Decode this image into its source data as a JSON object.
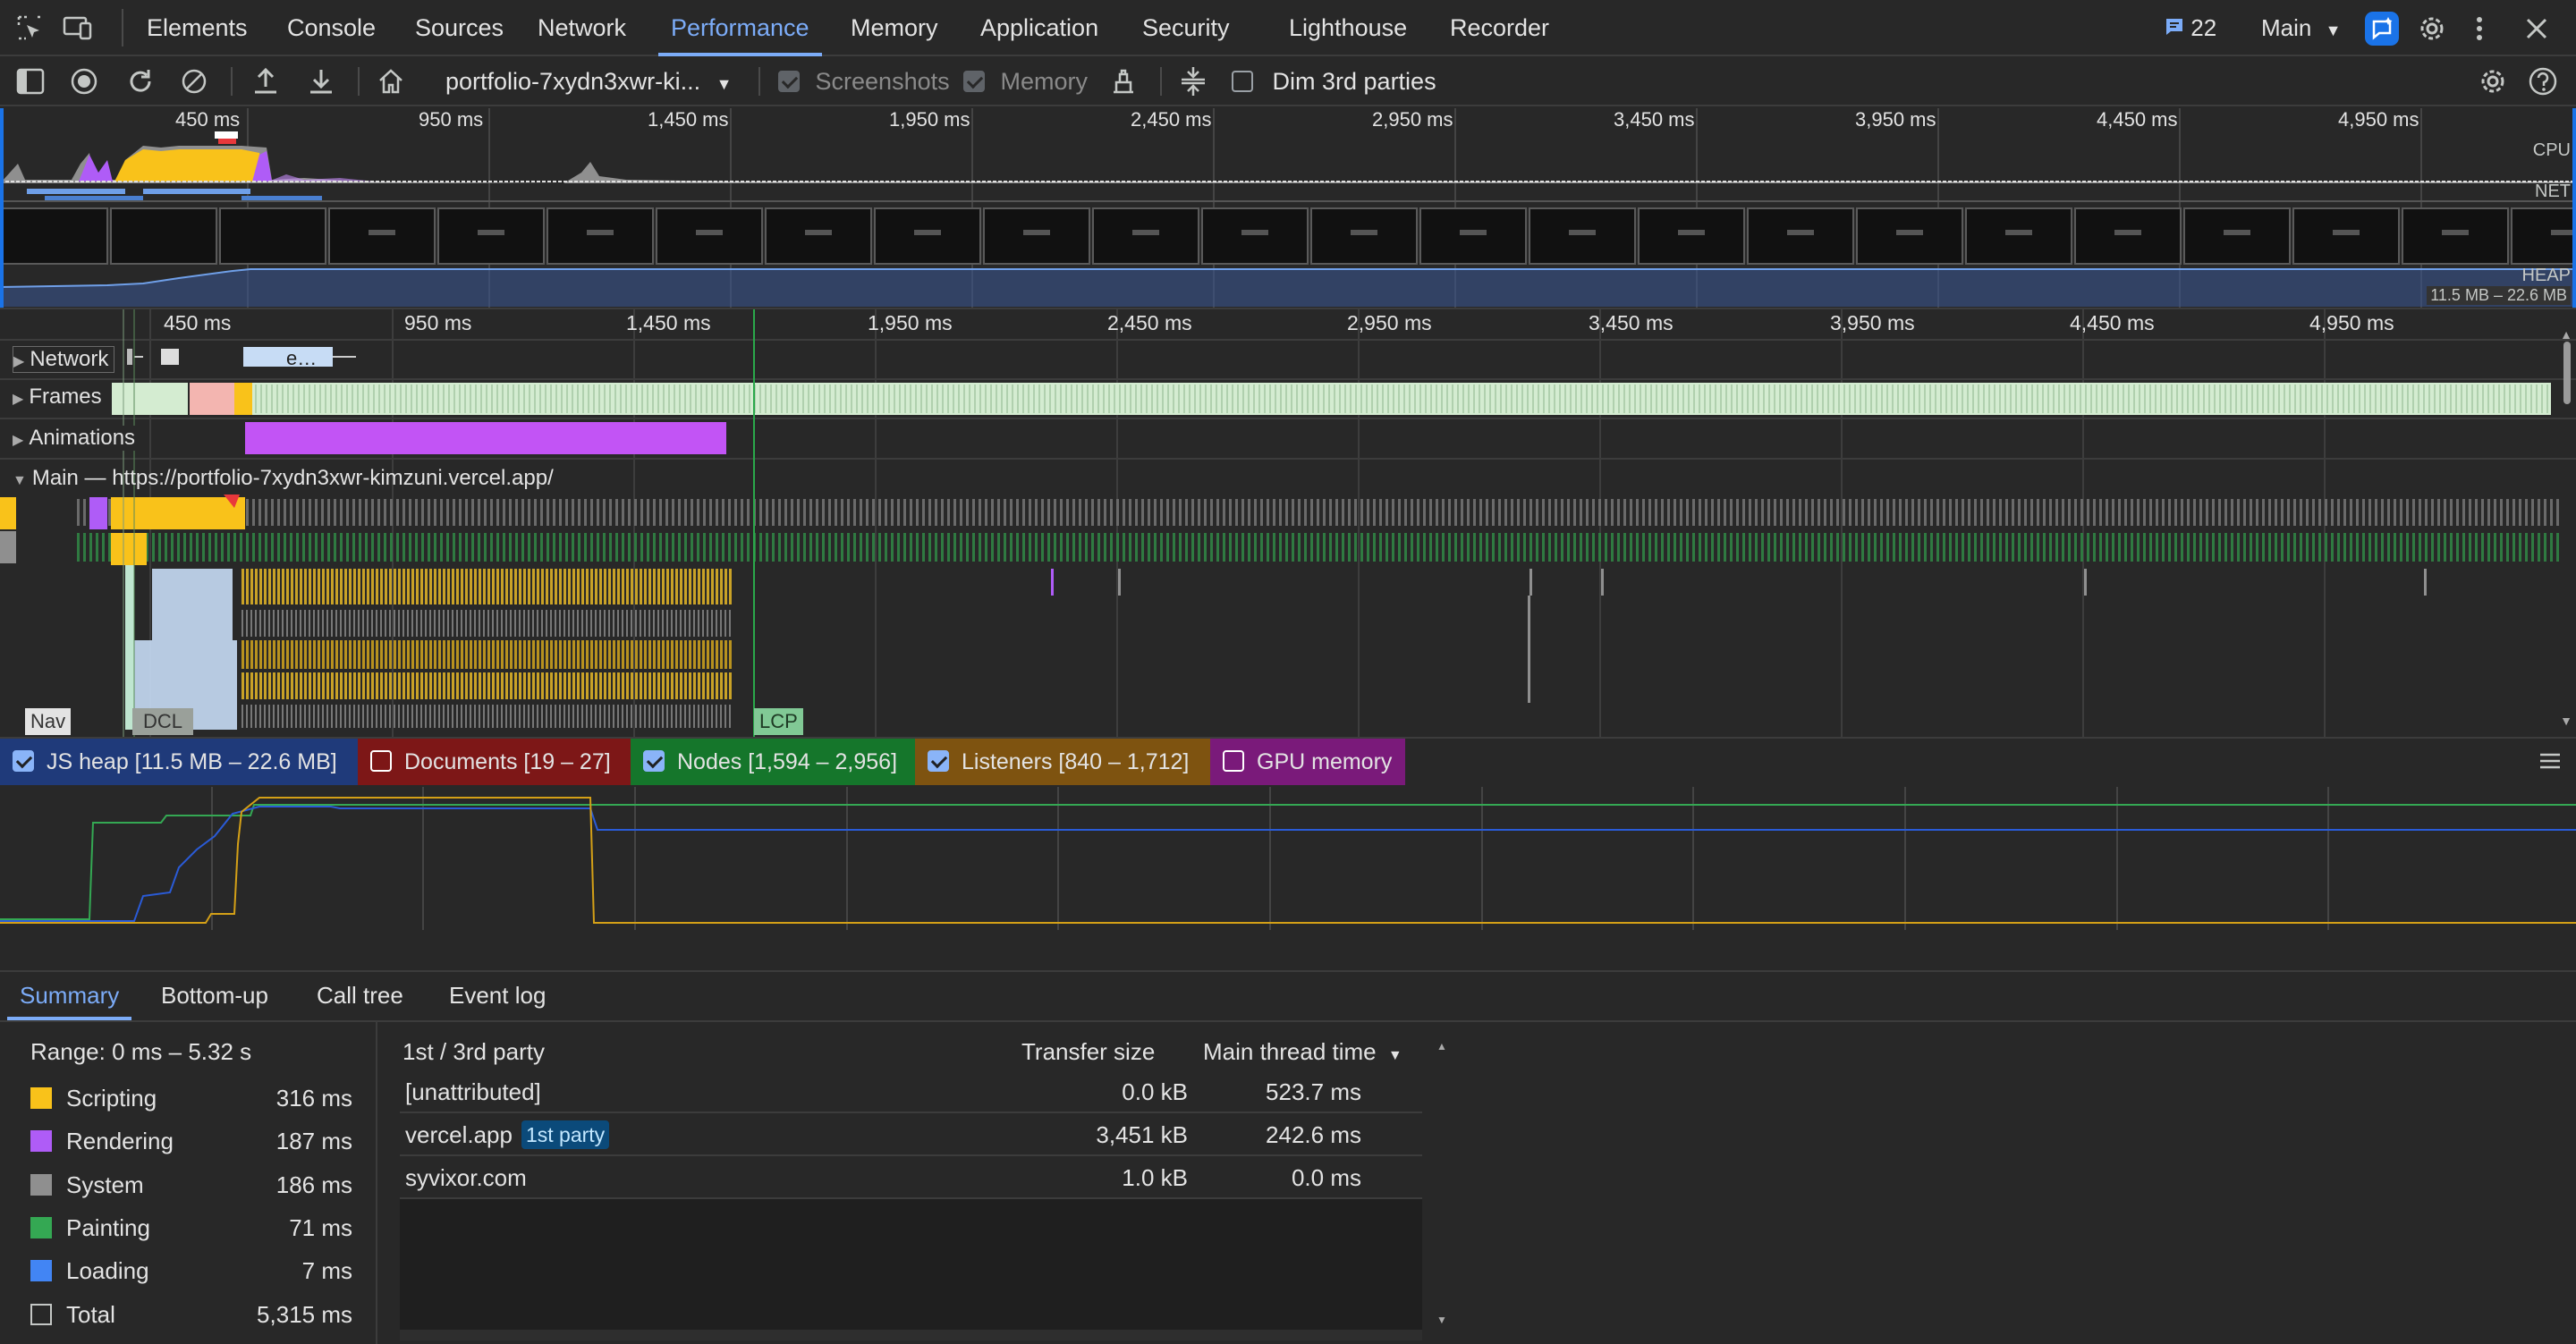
{
  "tabs": [
    "Elements",
    "Console",
    "Sources",
    "Network",
    "Performance",
    "Memory",
    "Application",
    "Security",
    "Lighthouse",
    "Recorder"
  ],
  "issues_count": "22",
  "context_selector": "Main",
  "toolbar": {
    "recording_select": "portfolio-7xydn3xwr-ki...",
    "screenshots_label": "Screenshots",
    "memory_label": "Memory",
    "dim_label": "Dim 3rd parties"
  },
  "overview": {
    "ticks": [
      "450 ms",
      "950 ms",
      "1,450 ms",
      "1,950 ms",
      "2,450 ms",
      "2,950 ms",
      "3,450 ms",
      "3,950 ms",
      "4,450 ms",
      "4,950 ms"
    ],
    "cpu_label": "CPU",
    "net_label": "NET",
    "heap_label": "HEAP",
    "heap_range": "11.5 MB – 22.6 MB"
  },
  "timeline": {
    "ticks": [
      "450 ms",
      "950 ms",
      "1,450 ms",
      "1,950 ms",
      "2,450 ms",
      "2,950 ms",
      "3,450 ms",
      "3,950 ms",
      "4,450 ms",
      "4,950 ms"
    ],
    "tracks": {
      "network": "Network",
      "frames": "Frames",
      "animations": "Animations",
      "main": "Main — https://portfolio-7xydn3xwr-kimzuni.vercel.app/"
    },
    "network_bar_label": "e…",
    "markers": {
      "nav": "Nav",
      "dcl": "DCL",
      "lcp": "LCP"
    }
  },
  "counters": {
    "js_heap": "JS heap [11.5 MB – 22.6 MB]",
    "documents": "Documents [19 – 27]",
    "nodes": "Nodes [1,594 – 2,956]",
    "listeners": "Listeners [840 – 1,712]",
    "gpu": "GPU memory",
    "colors": {
      "js_heap": "#1a3a8a",
      "documents": "#8a1a1a",
      "nodes": "#1a7a2a",
      "listeners": "#8a5a14",
      "gpu": "#7a1a7a"
    }
  },
  "bottom_tabs": [
    "Summary",
    "Bottom-up",
    "Call tree",
    "Event log"
  ],
  "summary": {
    "range": "Range: 0 ms – 5.32 s",
    "items": [
      {
        "label": "Scripting",
        "value": "316 ms",
        "color": "#f9c21a"
      },
      {
        "label": "Rendering",
        "value": "187 ms",
        "color": "#af5cf7"
      },
      {
        "label": "System",
        "value": "186 ms",
        "color": "#8f8f8f"
      },
      {
        "label": "Painting",
        "value": "71 ms",
        "color": "#34a853"
      },
      {
        "label": "Loading",
        "value": "7 ms",
        "color": "#4285f4"
      },
      {
        "label": "Total",
        "value": "5,315 ms",
        "color": ""
      }
    ]
  },
  "party_table": {
    "headers": [
      "1st / 3rd party",
      "Transfer size",
      "Main thread time"
    ],
    "rows": [
      {
        "entity": "[unattributed]",
        "badge": "",
        "size": "0.0 kB",
        "time": "523.7 ms"
      },
      {
        "entity": "vercel.app",
        "badge": "1st party",
        "size": "3,451 kB",
        "time": "242.6 ms"
      },
      {
        "entity": "syvixor.com",
        "badge": "",
        "size": "1.0 kB",
        "time": "0.0 ms"
      }
    ]
  }
}
